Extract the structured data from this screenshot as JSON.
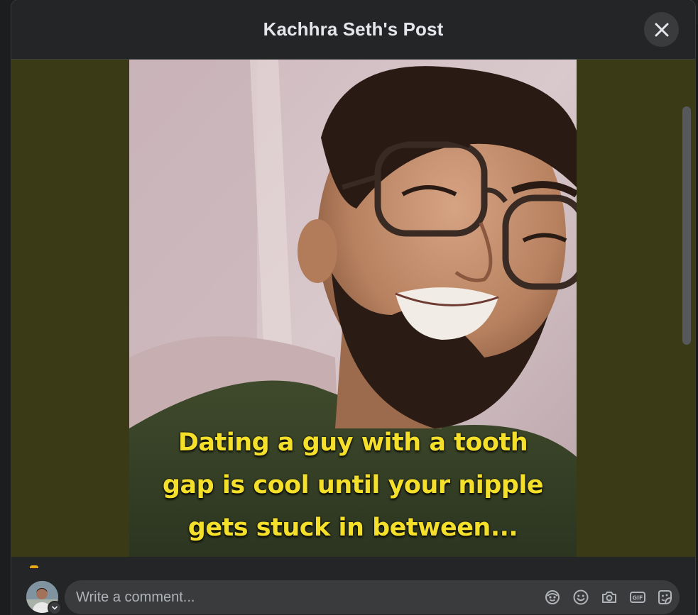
{
  "dialog": {
    "title": "Kachhra Seth's Post",
    "close_icon": "close-icon"
  },
  "post": {
    "caption_lines": [
      "Dating a guy with a tooth",
      "gap is cool until your nipple",
      "gets stuck in between..."
    ]
  },
  "composer": {
    "placeholder": "Write a comment...",
    "icons": [
      "avatar-sticker-icon",
      "emoji-icon",
      "camera-icon",
      "gif-icon",
      "sticker-icon"
    ],
    "gif_label": "GIF"
  },
  "colors": {
    "dialog_bg": "#242526",
    "media_bg": "#3a3a17",
    "caption": "#f4e02a",
    "text_primary": "#e4e6eb",
    "text_secondary": "#b0b3b8"
  }
}
